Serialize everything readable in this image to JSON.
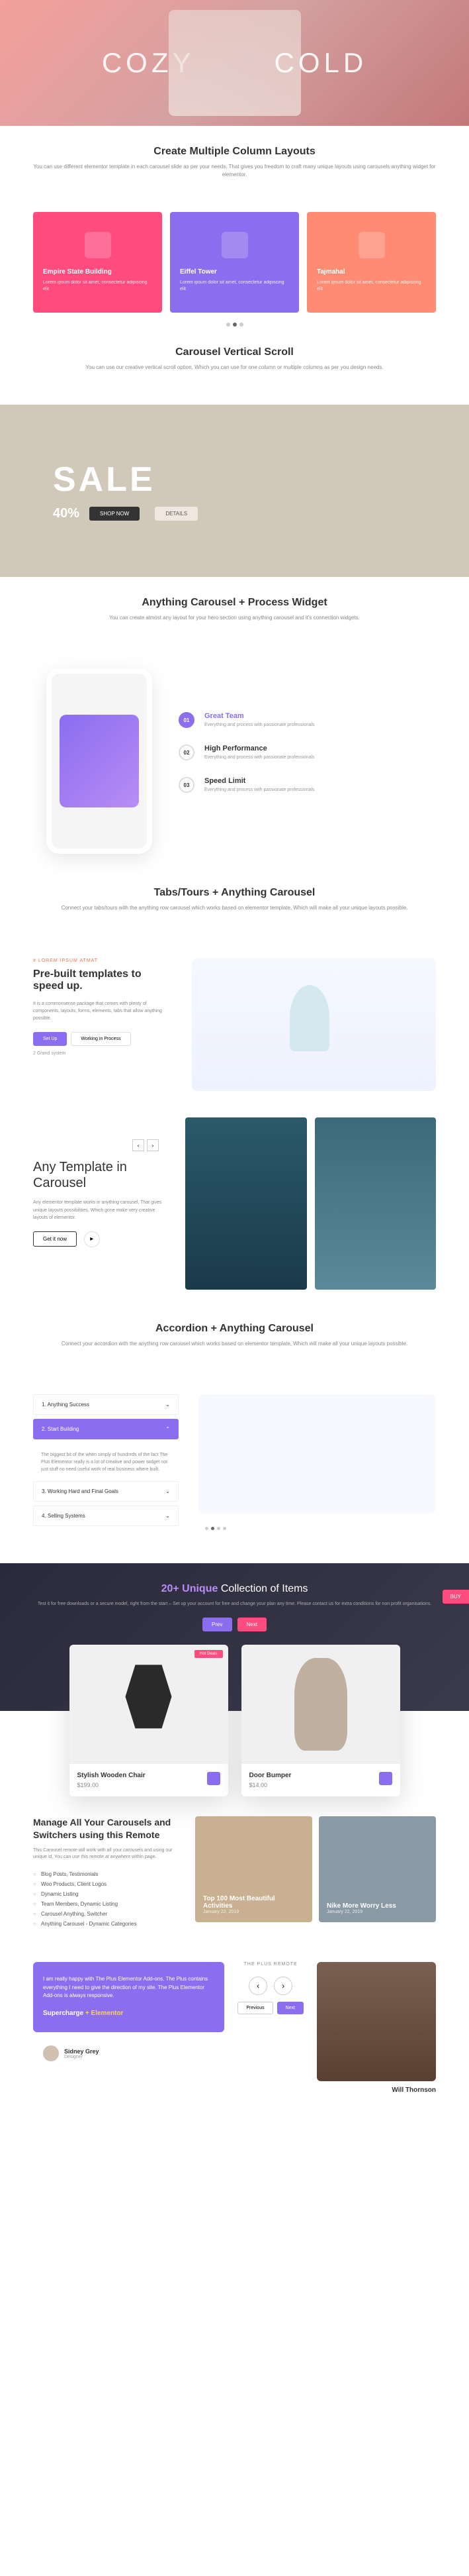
{
  "hero": {
    "left": "COZY",
    "right": "COLD"
  },
  "multi_col": {
    "title": "Create Multiple Column Layouts",
    "sub": "You can use different elementor template in each carousel slide as per your needs, That gives you freedom to craft many unique layouts using carousels anything widget for elementor.",
    "cards": [
      {
        "title": "Empire State Building",
        "text": "Lorem ipsum dolor sit amet, consectetur adipiscing elit"
      },
      {
        "title": "Eiffel Tower",
        "text": "Lorem ipsum dolor sit amet, consectetur adipiscing elit"
      },
      {
        "title": "Tajmahal",
        "text": "Lorem ipsum dolor sit amet, consectetur adipiscing elit"
      }
    ]
  },
  "vert_scroll": {
    "title": "Carousel Vertical Scroll",
    "sub": "You can use our creative vertical scroll option, Which you can use for one column or multiple columns as per you design needs.",
    "sale": "SALE",
    "pct": "40%",
    "btn1": "SHOP NOW",
    "btn2": "DETAILS"
  },
  "process": {
    "title": "Anything Carousel + Process Widget",
    "sub": "You can create almost any layout for your hero section using anything carousel and it's connection widgets.",
    "items": [
      {
        "num": "01",
        "title": "Great Team",
        "text": "Everything and process with passionate professionals"
      },
      {
        "num": "02",
        "title": "High Performance",
        "text": "Everything and process with passionate professionals"
      },
      {
        "num": "03",
        "title": "Speed Limit",
        "text": "Everything and process with passionate professionals"
      }
    ]
  },
  "tabs": {
    "title": "Tabs/Tours + Anything Carousel",
    "sub": "Connect your tabs/tours with the anything row carousel which works based on elementor template, Which will make all your unique layouts possible.",
    "eyebrow": "# LOREM IPSUM ATMAT",
    "heading_1": "Pre-built ",
    "heading_2": "templates",
    "heading_3": " to speed up.",
    "text": "It is a commonsense package that comes with plenty of components, layouts, forms, elements, tabs that allow anything possible.",
    "btn1": "Set Up",
    "btn2": "Working in Process",
    "stat": "2 Grand system"
  },
  "template": {
    "title": "Any Template in Carousel",
    "text": "Any elementor template works in anything carousel, That gives unique layouts possibilities. Which gone make very creative layouts of elementor.",
    "btn": "Get it now"
  },
  "accordion": {
    "title": "Accordion + Anything Carousel",
    "sub": "Connect your accordion with the anything row carousel which works based on elementor template, Which will make all your unique layouts possible.",
    "items": [
      "1. Anything Success",
      "2. Start Building",
      "3. Working Hard and Final Goals",
      "4. Selling Systems"
    ],
    "panel": "The biggest bit of the when simply of hundreds of the fact The Plus Elementor really is a lot of creative and power widget not just stuff no need useful work of real business where built."
  },
  "collection": {
    "title_1": "20+ Unique ",
    "title_2": "Collection of Items",
    "text": "Test it for free downloads or a secure model, right from the start – Set up your account for free and change your plan any time. Please contact us for extra conditions for non profit organisations.",
    "prev": "Prev",
    "next": "Next",
    "buy": "BUY"
  },
  "products": [
    {
      "name": "Stylish Wooden Chair",
      "price": "$199.00",
      "badge": "Hot Deals"
    },
    {
      "name": "Door Bumper",
      "price": "$14.00",
      "badge": ""
    }
  ],
  "remote": {
    "title": "Manage All Your Carousels and Switchers using this Remote",
    "text": "This Carousel remote will work with all your carousels and using our unique id, You can use this remote at anywhere within page.",
    "list": [
      "Blog Posts, Testimonials",
      "Woo Products, Client Logos",
      "Dynamic Listing",
      "Team Members, Dynamic Listing",
      "Carousel Anything, Switcher",
      "Anything Carousel - Dynamic Categories"
    ],
    "imgs": [
      {
        "title": "Top 100 Most Beautiful Activities",
        "meta": "January 22, 2019"
      },
      {
        "title": "Nike More Worry Less",
        "meta": "January 22, 2019"
      }
    ]
  },
  "testimonial": {
    "text": "I am really happy with The Plus Elementor Add-ons. The Plus contains everything I need to give the direction of my site. The Plus Elementor Add-ons is always responsive.",
    "supercharge_1": "Supercharge",
    "supercharge_2": " + Elementor",
    "author": "Sidney Grey",
    "role": "Designer"
  },
  "remote_ctrl": {
    "title": "THE PLUS REMOTE",
    "prev": "Previous",
    "next": "Next"
  },
  "profile": {
    "name": "Will Thornson"
  }
}
